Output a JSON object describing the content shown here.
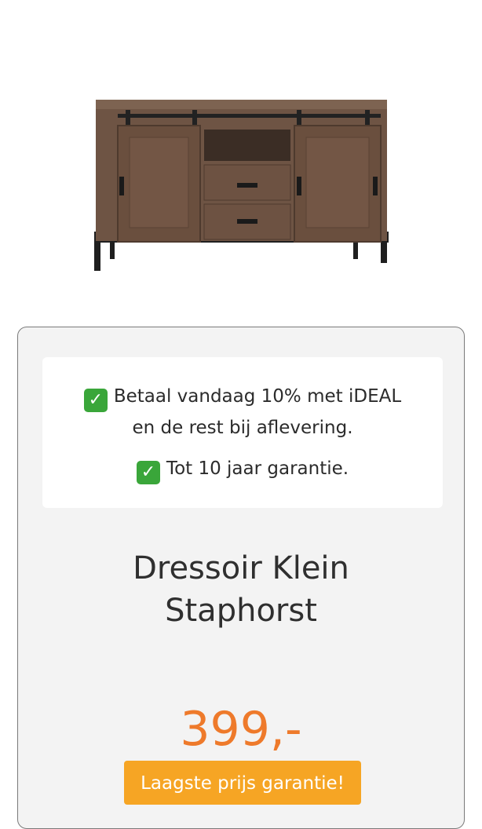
{
  "product": {
    "image_alt": "Dressoir Klein Staphorst",
    "title_line1": "Dressoir Klein",
    "title_line2": "Staphorst",
    "price": "399,-",
    "guarantee_button": "Laagste prijs garantie!"
  },
  "usp": {
    "line1": "Betaal vandaag 10% met iDEAL",
    "line2": "en de rest bij aflevering.",
    "line3": "Tot 10 jaar garantie."
  },
  "colors": {
    "price": "#ee7a2b",
    "button": "#f6a524",
    "check": "#3aa63a"
  },
  "icons": [
    "check-icon"
  ]
}
